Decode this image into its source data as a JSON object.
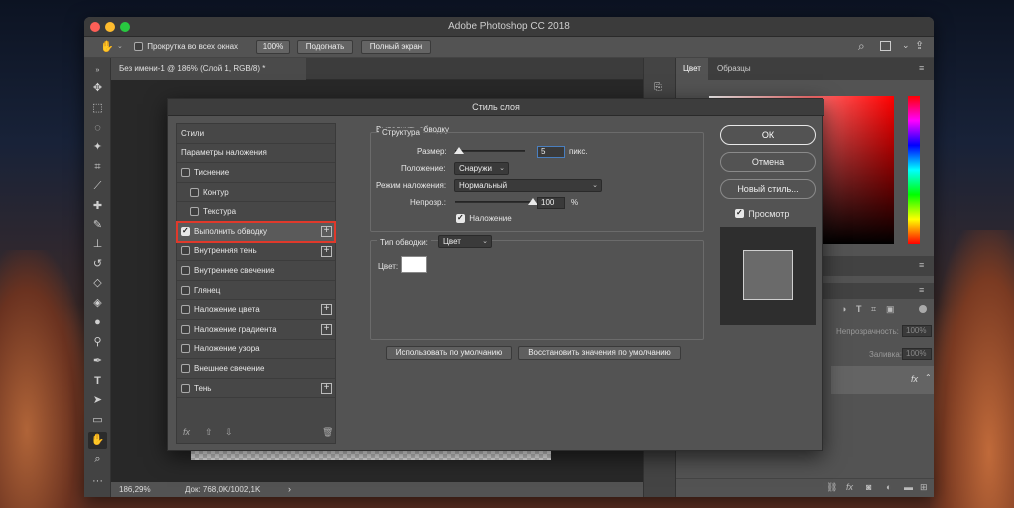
{
  "window": {
    "title": "Adobe Photoshop CC 2018",
    "traffic_colors": [
      "#fe5f57",
      "#febc2e",
      "#28c840"
    ]
  },
  "options_bar": {
    "scroll_all_windows_label": "Прокрутка во всех окнах",
    "zoom_100_label": "100%",
    "fit_screen_label": "Подогнать",
    "fill_screen_label": "Полный экран"
  },
  "document": {
    "tab_title": "Без имени-1 @ 186% (Слой 1, RGB/8) *",
    "zoom": "186,29%",
    "doc_info": "Док: 768,0K/1002,1K",
    "arrow": "›"
  },
  "right_panel": {
    "tabs": [
      "Цвет",
      "Образцы"
    ],
    "opacity_label": "Непрозрачность:",
    "opacity_value": "100%",
    "fill_label": "Заливка:",
    "fill_value": "100%",
    "fx_label": "fx",
    "menu_icon": "≡"
  },
  "dialog": {
    "title": "Стиль слоя",
    "styles_header": "Стили",
    "blend_options": "Параметры наложения",
    "items": [
      {
        "label": "Тиснение",
        "checked": false,
        "sub": false,
        "plus": false
      },
      {
        "label": "Контур",
        "checked": false,
        "sub": true,
        "plus": false
      },
      {
        "label": "Текстура",
        "checked": false,
        "sub": true,
        "plus": false
      },
      {
        "label": "Выполнить обводку",
        "checked": true,
        "sub": false,
        "plus": true,
        "selected": true
      },
      {
        "label": "Внутренняя тень",
        "checked": false,
        "sub": false,
        "plus": true
      },
      {
        "label": "Внутреннее свечение",
        "checked": false,
        "sub": false,
        "plus": false
      },
      {
        "label": "Глянец",
        "checked": false,
        "sub": false,
        "plus": false
      },
      {
        "label": "Наложение цвета",
        "checked": false,
        "sub": false,
        "plus": true
      },
      {
        "label": "Наложение градиента",
        "checked": false,
        "sub": false,
        "plus": true
      },
      {
        "label": "Наложение узора",
        "checked": false,
        "sub": false,
        "plus": false
      },
      {
        "label": "Внешнее свечение",
        "checked": false,
        "sub": false,
        "plus": false
      },
      {
        "label": "Тень",
        "checked": false,
        "sub": false,
        "plus": true
      }
    ],
    "footer_fx": "fx",
    "section_title": "Выполнить обводку",
    "structure_title": "Структура",
    "size_label": "Размер:",
    "size_value": "5",
    "size_unit": "пикс.",
    "size_fraction": 0.05,
    "position_label": "Положение:",
    "position_value": "Снаружи",
    "blend_mode_label": "Режим наложения:",
    "blend_mode_value": "Нормальный",
    "opacity_label": "Непрозр.:",
    "opacity_value": "100",
    "opacity_unit": "%",
    "opacity_fraction": 1.0,
    "overprint_label": "Наложение",
    "fill_type_label": "Тип обводки:",
    "fill_type_value": "Цвет",
    "color_label": "Цвет:",
    "stroke_color": "#ffffff",
    "make_default": "Использовать по умолчанию",
    "reset_default": "Восстановить значения по умолчанию",
    "ok": "ОК",
    "cancel": "Отмена",
    "new_style": "Новый стиль...",
    "preview_label": "Просмотр"
  }
}
